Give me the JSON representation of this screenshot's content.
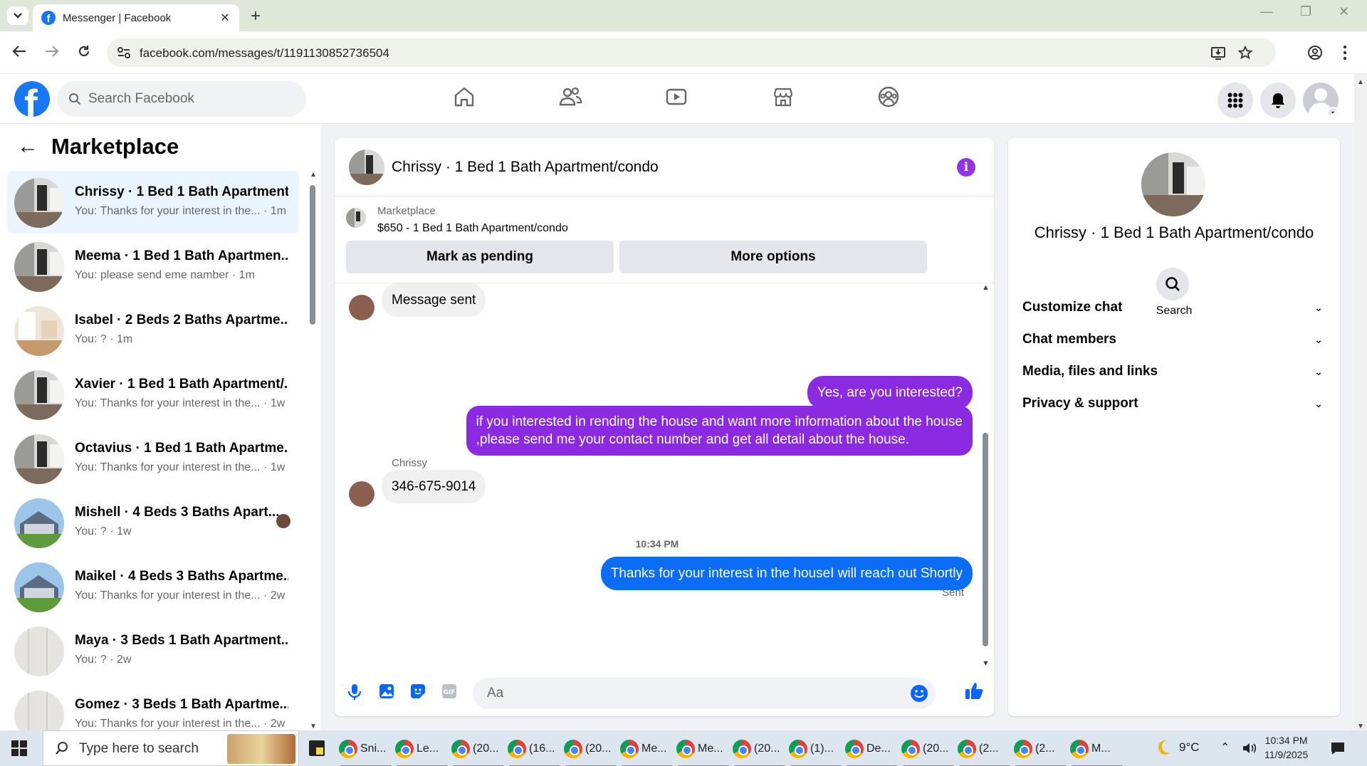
{
  "browser": {
    "tab_title": "Messenger | Facebook",
    "url": "facebook.com/messages/t/1191130852736504",
    "icons": [
      "tab-search-icon",
      "close-icon",
      "plus-icon",
      "back-arrow-icon",
      "forward-arrow-icon",
      "reload-icon",
      "site-settings-icon",
      "install-app-icon",
      "bookmark-star-icon",
      "profile-icon",
      "kebab-menu-icon"
    ]
  },
  "fb_nav": {
    "logo": "f",
    "search_placeholder": "Search Facebook",
    "icons": [
      "home-icon",
      "friends-icon",
      "video-icon",
      "marketplace-icon",
      "groups-icon",
      "menu-grid-icon",
      "bell-icon"
    ]
  },
  "sidebar": {
    "title": "Marketplace",
    "conversations": [
      {
        "name": "Chrissy · 1 Bed 1 Bath Apartment...",
        "preview": "You: Thanks for your interest in the... · 1m",
        "active": true,
        "thumb": "kitchen"
      },
      {
        "name": "Meema · 1 Bed 1 Bath Apartmen...",
        "preview": "You: please send eme namber · 1m",
        "active": false,
        "thumb": "kitchen"
      },
      {
        "name": "Isabel · 2 Beds 2 Baths Apartme...",
        "preview": "You: ? · 1m",
        "active": false,
        "thumb": "room"
      },
      {
        "name": "Xavier · 1 Bed 1 Bath Apartment/...",
        "preview": "You: Thanks for your interest in the... · 1w",
        "active": false,
        "thumb": "kitchen"
      },
      {
        "name": "Octavius · 1 Bed 1 Bath Apartme...",
        "preview": "You: Thanks for your interest in the... · 1w",
        "active": false,
        "thumb": "kitchen"
      },
      {
        "name": "Mishell · 4 Beds 3 Baths Apart...",
        "preview": "You: ? · 1w",
        "active": false,
        "thumb": "house"
      },
      {
        "name": "Maikel · 4 Beds 3 Baths Apartme...",
        "preview": "You: Thanks for your interest in the... · 2w",
        "active": false,
        "thumb": "house"
      },
      {
        "name": "Maya · 3 Beds 1 Bath Apartment...",
        "preview": "You: ? · 2w",
        "active": false,
        "thumb": "wall"
      },
      {
        "name": "Gomez · 3 Beds 1 Bath Apartme...",
        "preview": "You: Thanks for your interest in the... · 2w",
        "active": false,
        "thumb": "wall"
      }
    ]
  },
  "chat": {
    "header_name": "Chrissy · 1 Bed 1 Bath Apartment/condo",
    "marketplace_label": "Marketplace",
    "listing": "$650 - 1 Bed 1 Bath Apartment/condo",
    "btn_pending": "Mark as pending",
    "btn_more": "More options",
    "messages": {
      "m1": "Message sent",
      "m2": "Yes, are you interested?",
      "m3a": "if you interested in rending the house and want more information about the house",
      "m3b": ",please send me your contact number and get all detail about the house.",
      "sender": "Chrissy",
      "m4": "346-675-9014",
      "timestamp": "10:34 PM",
      "m5": "Thanks for your interest in the houseI will reach out Shortly",
      "status": "Sent"
    },
    "composer_placeholder": "Aa"
  },
  "right_panel": {
    "name": "Chrissy · 1 Bed 1 Bath Apartment/condo",
    "search_label": "Search",
    "sections": [
      "Customize chat",
      "Chat members",
      "Media, files and links",
      "Privacy & support"
    ]
  },
  "taskbar": {
    "search_placeholder": "Type here to search",
    "apps": [
      "Sni...",
      "Le...",
      "(20...",
      "(16...",
      "(20...",
      "Me...",
      "Me...",
      "(20...",
      "(1)...",
      "De...",
      "(20...",
      "(2...",
      "(2...",
      "M..."
    ],
    "weather": "9°C",
    "time": "10:34 PM",
    "date": "11/9/2025"
  },
  "colors": {
    "fb_blue": "#1877f2",
    "outgoing_purple": "#8a2be2",
    "outgoing_blue": "#0b6cf5",
    "active_row": "#ebf5ff"
  }
}
